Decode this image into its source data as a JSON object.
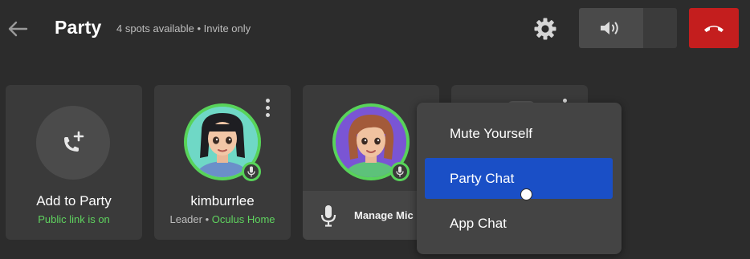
{
  "header": {
    "title": "Party",
    "subtitle": "4 spots available • Invite only"
  },
  "cards": {
    "add": {
      "label": "Add to Party",
      "sub": "Public link is on"
    },
    "user1": {
      "name": "kimburrlee",
      "role": "Leader",
      "separator": " • ",
      "location": "Oculus Home"
    },
    "user2": {
      "manage_label": "Manage Mic"
    }
  },
  "menu": {
    "items": [
      "Mute Yourself",
      "Party Chat",
      "App Chat"
    ],
    "selected": "Party Chat"
  },
  "colors": {
    "background": "#2c2c2c",
    "card": "#3a3a3a",
    "accent_green": "#58d35a",
    "selection_blue": "#1a4fc6",
    "hangup_red": "#c41e1e"
  },
  "icons": [
    "back-arrow-icon",
    "gear-icon",
    "speaker-icon",
    "phone-hangup-icon",
    "add-call-icon",
    "microphone-icon",
    "more-vertical-icon"
  ]
}
